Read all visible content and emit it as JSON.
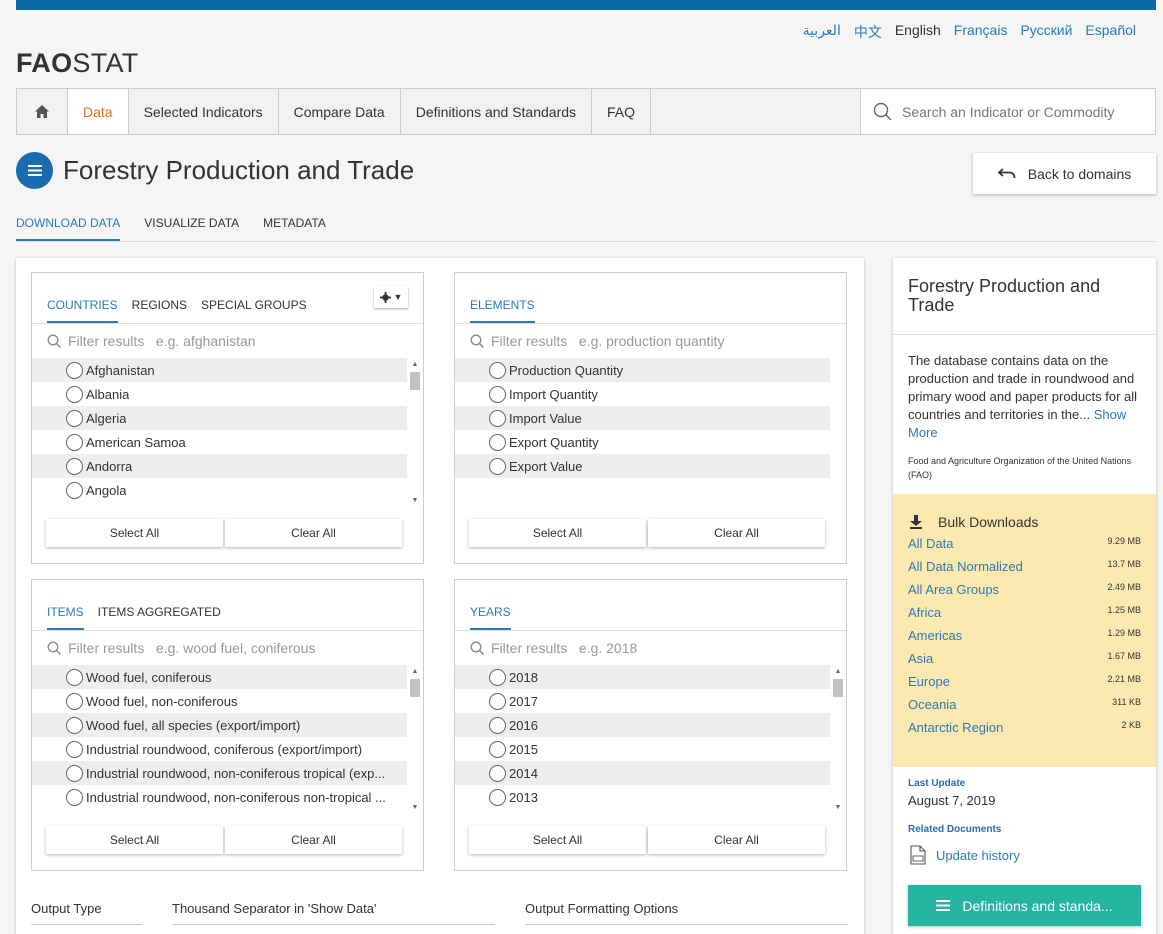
{
  "languages": [
    "العربية",
    "中文",
    "English",
    "Français",
    "Русский",
    "Español"
  ],
  "active_language": "English",
  "logo": {
    "bold": "FAO",
    "rest": "STAT"
  },
  "nav": {
    "items": [
      "Data",
      "Selected Indicators",
      "Compare Data",
      "Definitions and Standards",
      "FAQ"
    ],
    "active": "Data",
    "search_placeholder": "Search an Indicator or Commodity"
  },
  "page": {
    "title": "Forestry Production and Trade",
    "back_label": "Back to domains"
  },
  "subtabs": [
    "DOWNLOAD DATA",
    "VISUALIZE DATA",
    "METADATA"
  ],
  "panels": {
    "countries": {
      "tabs": [
        "COUNTRIES",
        "REGIONS",
        "SPECIAL GROUPS"
      ],
      "placeholder": "Filter results   e.g. afghanistan",
      "items": [
        "Afghanistan",
        "Albania",
        "Algeria",
        "American Samoa",
        "Andorra",
        "Angola"
      ]
    },
    "elements": {
      "tabs": [
        "ELEMENTS"
      ],
      "placeholder": "Filter results   e.g. production quantity",
      "items": [
        "Production Quantity",
        "Import Quantity",
        "Import Value",
        "Export Quantity",
        "Export Value"
      ]
    },
    "items": {
      "tabs": [
        "ITEMS",
        "ITEMS AGGREGATED"
      ],
      "placeholder": "Filter results   e.g. wood fuel, coniferous",
      "items": [
        "Wood fuel, coniferous",
        "Wood fuel, non-coniferous",
        "Wood fuel, all species (export/import)",
        "Industrial roundwood, coniferous (export/import)",
        "Industrial roundwood, non-coniferous tropical (exp...",
        "Industrial roundwood, non-coniferous non-tropical ..."
      ]
    },
    "years": {
      "tabs": [
        "YEARS"
      ],
      "placeholder": "Filter results   e.g. 2018",
      "items": [
        "2018",
        "2017",
        "2016",
        "2015",
        "2014",
        "2013"
      ]
    },
    "select_all": "Select All",
    "clear_all": "Clear All"
  },
  "options": {
    "output_type": "Output Type",
    "thousand_separator": "Thousand Separator in 'Show Data'",
    "output_formatting": "Output Formatting Options"
  },
  "sidebar": {
    "title": "Forestry Production and Trade",
    "description": "The database contains data on the production and trade in roundwood and primary wood and paper products for all countries and territories in the...",
    "show_more": "Show More",
    "organization": "Food and Agriculture Organization of the United Nations (FAO)",
    "bulk_title": "Bulk Downloads",
    "bulk": [
      {
        "name": "All Data",
        "size": "9.29 MB"
      },
      {
        "name": "All Data Normalized",
        "size": "13.7 MB"
      },
      {
        "name": "All Area Groups",
        "size": "2.49 MB"
      },
      {
        "name": "Africa",
        "size": "1.25 MB"
      },
      {
        "name": "Americas",
        "size": "1.29 MB"
      },
      {
        "name": "Asia",
        "size": "1.67 MB"
      },
      {
        "name": "Europe",
        "size": "2.21 MB"
      },
      {
        "name": "Oceania",
        "size": "311 KB"
      },
      {
        "name": "Antarctic Region",
        "size": "2 KB"
      }
    ],
    "last_update_label": "Last Update",
    "last_update": "August 7, 2019",
    "related_docs_label": "Related Documents",
    "update_history": "Update history",
    "definitions_button": "Definitions and standa..."
  },
  "colors": {
    "brand_blue": "#0a6aa1",
    "link": "#2a7ab9",
    "active_orange": "#e07020",
    "bulk_bg": "#fce9b0",
    "teal": "#26b5a0"
  }
}
